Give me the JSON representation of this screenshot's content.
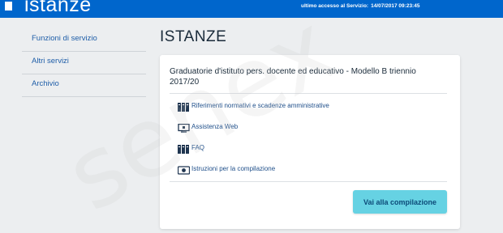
{
  "header": {
    "logo_text": "istanze",
    "last_access_label": "ultimo accesso al Servizio:",
    "last_access_value": "14/07/2017 09:23:45"
  },
  "sidebar": {
    "items": [
      {
        "label": "Funzioni di servizio"
      },
      {
        "label": "Altri servizi"
      },
      {
        "label": "Archivio"
      }
    ]
  },
  "main": {
    "title": "ISTANZE",
    "card": {
      "title": "Graduatorie d'istituto pers. docente ed educativo - Modello B triennio 2017/20",
      "links": [
        {
          "label": "Riferimenti normativi e scadenze amministrative",
          "icon": "books-icon"
        },
        {
          "label": "Assistenza Web",
          "icon": "monitor-icon"
        },
        {
          "label": "FAQ",
          "icon": "books-icon"
        },
        {
          "label": "Istruzioni per la compilazione",
          "icon": "video-icon"
        }
      ],
      "cta_label": "Vai alla compilazione"
    }
  },
  "watermark": "senex",
  "colors": {
    "header_bg": "#0066cc",
    "cta_bg": "#66d2e3",
    "link": "#1f4f8a"
  }
}
